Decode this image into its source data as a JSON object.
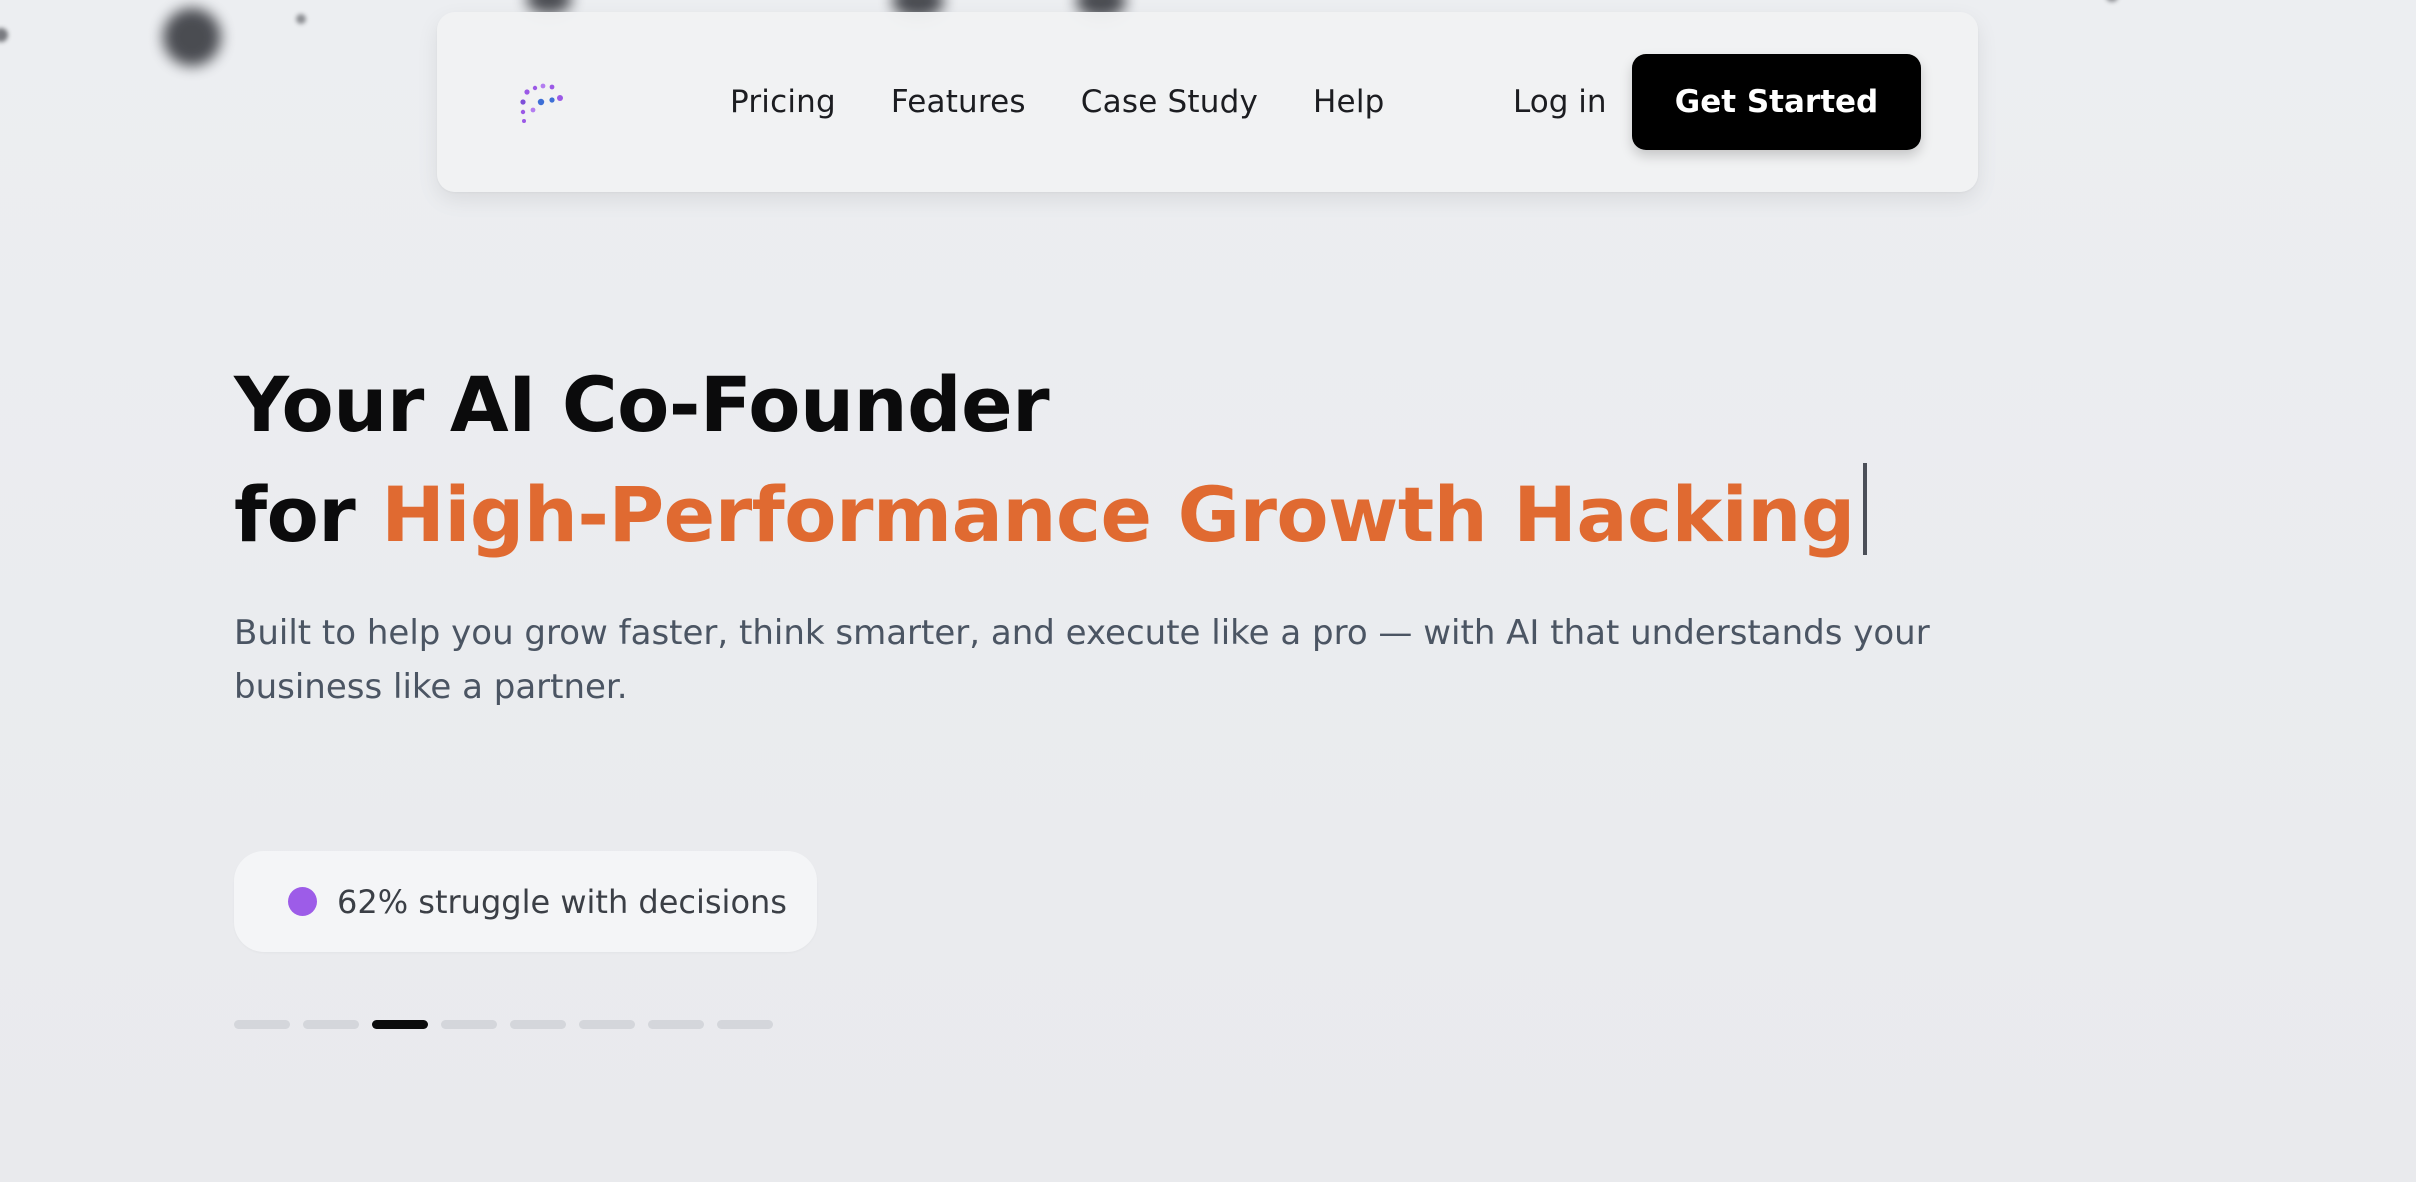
{
  "nav": {
    "links": [
      "Pricing",
      "Features",
      "Case Study",
      "Help"
    ],
    "login_label": "Log in",
    "cta_label": "Get Started"
  },
  "hero": {
    "headline_line1": "Your AI Co-Founder",
    "headline_prefix": "for",
    "headline_accent": "High-Performance Growth Hacking",
    "subtitle": "Built to help you grow faster, think smarter, and execute like a pro — with AI that understands your business like a partner.",
    "stat_text": "62% struggle with decisions"
  },
  "carousel": {
    "slide_count": 8,
    "active_index": 2
  },
  "colors": {
    "accent": "#e06a31",
    "cta_bg": "#000000",
    "stat_dot": "#9d5ce8",
    "logo_purple": "#9b59e6",
    "logo_blue": "#3d6fd6"
  },
  "icons": {
    "logo": "dotted-logo-icon",
    "stat": "status-dot-icon"
  }
}
